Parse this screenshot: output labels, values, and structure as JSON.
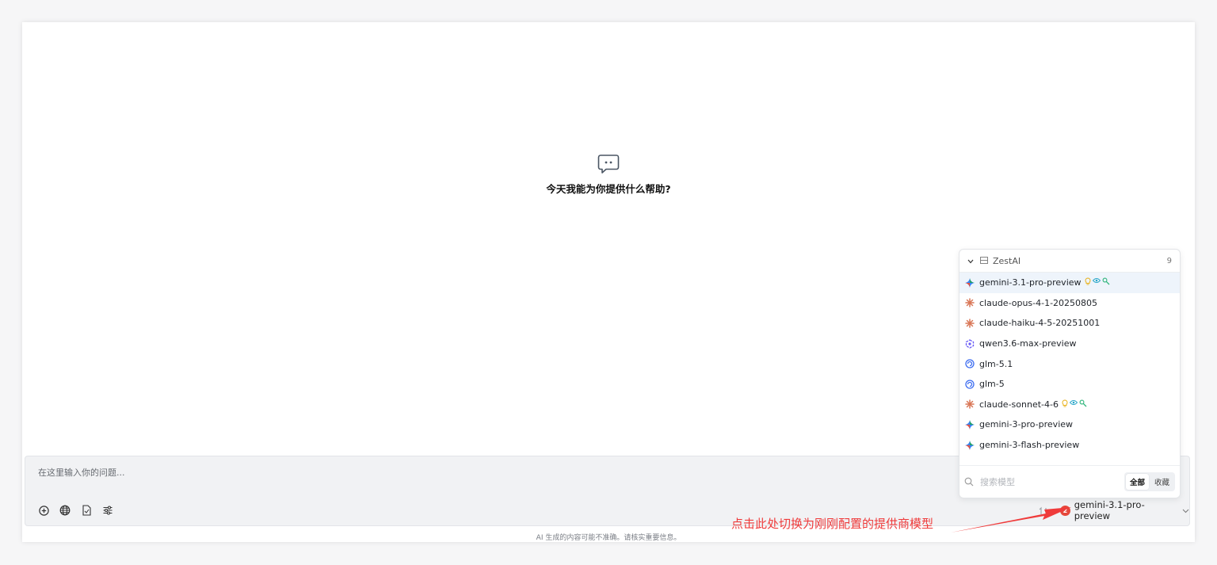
{
  "welcome": {
    "text": "今天我能为你提供什么帮助?"
  },
  "composer": {
    "placeholder": "在这里输入你的问题...",
    "tools": [
      "add-icon",
      "globe-icon",
      "document-icon",
      "sliders-icon"
    ],
    "model_badge": "2",
    "current_model": "gemini-3.1-pro-preview"
  },
  "footer": {
    "note": "AI 生成的内容可能不准确。请核实重要信息。"
  },
  "dropdown": {
    "provider": "ZestAI",
    "count": "9",
    "search_placeholder": "搜索模型",
    "filter_all": "全部",
    "filter_fav": "收藏",
    "models": [
      {
        "name": "gemini-3.1-pro-preview",
        "icon": "gemini-icon",
        "caps": true,
        "selected": true
      },
      {
        "name": "claude-opus-4-1-20250805",
        "icon": "claude-icon"
      },
      {
        "name": "claude-haiku-4-5-20251001",
        "icon": "claude-icon"
      },
      {
        "name": "qwen3.6-max-preview",
        "icon": "qwen-icon"
      },
      {
        "name": "glm-5.1",
        "icon": "glm-icon"
      },
      {
        "name": "glm-5",
        "icon": "glm-icon"
      },
      {
        "name": "claude-sonnet-4-6",
        "icon": "claude-icon",
        "caps": true
      },
      {
        "name": "gemini-3-pro-preview",
        "icon": "gemini-icon"
      },
      {
        "name": "gemini-3-flash-preview",
        "icon": "gemini-icon"
      }
    ]
  },
  "annotation": {
    "text": "点击此处切换为刚刚配置的提供商模型"
  },
  "colors": {
    "accent_red": "#ef3b3b",
    "selected_bg": "#eef4fb"
  }
}
